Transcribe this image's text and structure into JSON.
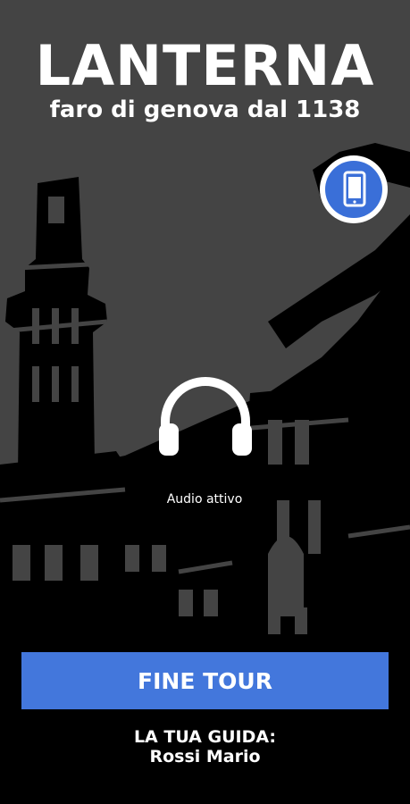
{
  "header": {
    "title": "LANTERNA",
    "subtitle": "faro di genova dal 1138"
  },
  "device_button": {
    "icon": "smartphone-icon",
    "color": "#3a6fd8"
  },
  "audio": {
    "icon": "headphones-icon",
    "label": "Audio attivo"
  },
  "end_tour": {
    "label": "FINE TOUR",
    "color": "#4377dc"
  },
  "guide": {
    "heading": "LA TUA GUIDA:",
    "name": "Rossi Mario"
  },
  "colors": {
    "background": "#444444",
    "ink": "#000000",
    "text": "#ffffff"
  }
}
